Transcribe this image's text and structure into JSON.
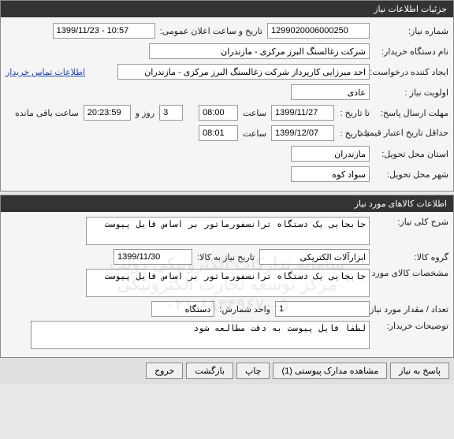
{
  "panel1": {
    "title": "جزئیات اطلاعات نیاز",
    "need_number_label": "شماره نیاز:",
    "need_number": "1299020006000250",
    "public_date_label": "تاریخ و ساعت اعلان عمومی:",
    "public_date": "1399/11/23 - 10:57",
    "buyer_org_label": "نام دستگاه خریدار:",
    "buyer_org": "شرکت زغالسنگ البرز مرکزی - مازندران",
    "requester_label": "ایجاد کننده درخواست:",
    "requester": "احد میرزایی کارپرداز شرکت زغالسنگ البرز مرکزی - مازندران",
    "contact_link": "اطلاعات تماس خریدار",
    "priority_label": "اولویت نیاز :",
    "priority": "عادی",
    "response_deadline_label": "مهلت ارسال پاسخ:",
    "to_date_label": "تا تاریخ :",
    "response_date": "1399/11/27",
    "time_label": "ساعت",
    "response_time": "08:00",
    "days_remaining": "3",
    "day_and_label": "روز و",
    "countdown": "20:23:59",
    "remaining_label": "ساعت باقی مانده",
    "min_validity_label": "حداقل تاریخ اعتبار قیمت:",
    "validity_date": "1399/12/07",
    "validity_time": "08:01",
    "province_label": "استان محل تحویل:",
    "province": "مازندران",
    "city_label": "شهر محل تحویل:",
    "city": "سواد کوه"
  },
  "panel2": {
    "title": "اطلاعات کالاهای مورد نیاز",
    "general_desc_label": "شرح کلی نیاز:",
    "general_desc": "جابجایی یک دستگاه ترانسفورماتور بر اساس فایل پیوست",
    "goods_group_label": "گروه کالا:",
    "goods_group": "ابزارآلات الکتریکی",
    "goods_date_label": "تاریخ نیاز به کالا:",
    "goods_date": "1399/11/30",
    "goods_spec_label": "مشخصات کالای مورد نیاز:",
    "goods_spec": "جابجایی یک دستگاه ترانسفورماتور بر اساس فایل پیوست",
    "quantity_label": "تعداد / مقدار مورد نیاز:",
    "quantity": "1",
    "unit_label": "واحد شمارش:",
    "unit": "دستگاه",
    "buyer_notes_label": "توضیحات خریدار:",
    "buyer_notes": "لطفا فایل پیوست به دقت مطالعه شود"
  },
  "buttons": {
    "respond": "پاسخ به نیاز",
    "attachments": "مشاهده مدارک پیوستی (1)",
    "print": "چاپ",
    "back": "بازگشت",
    "exit": "خروج"
  },
  "watermark": {
    "line1": "سامانه تدارکات الکترونیکی دولت",
    "line2": "مرکز توسعه تجارت الکترونیکی",
    "line3": "۰۲۱-۸۸۳۴۹۶۷۰-۵"
  }
}
